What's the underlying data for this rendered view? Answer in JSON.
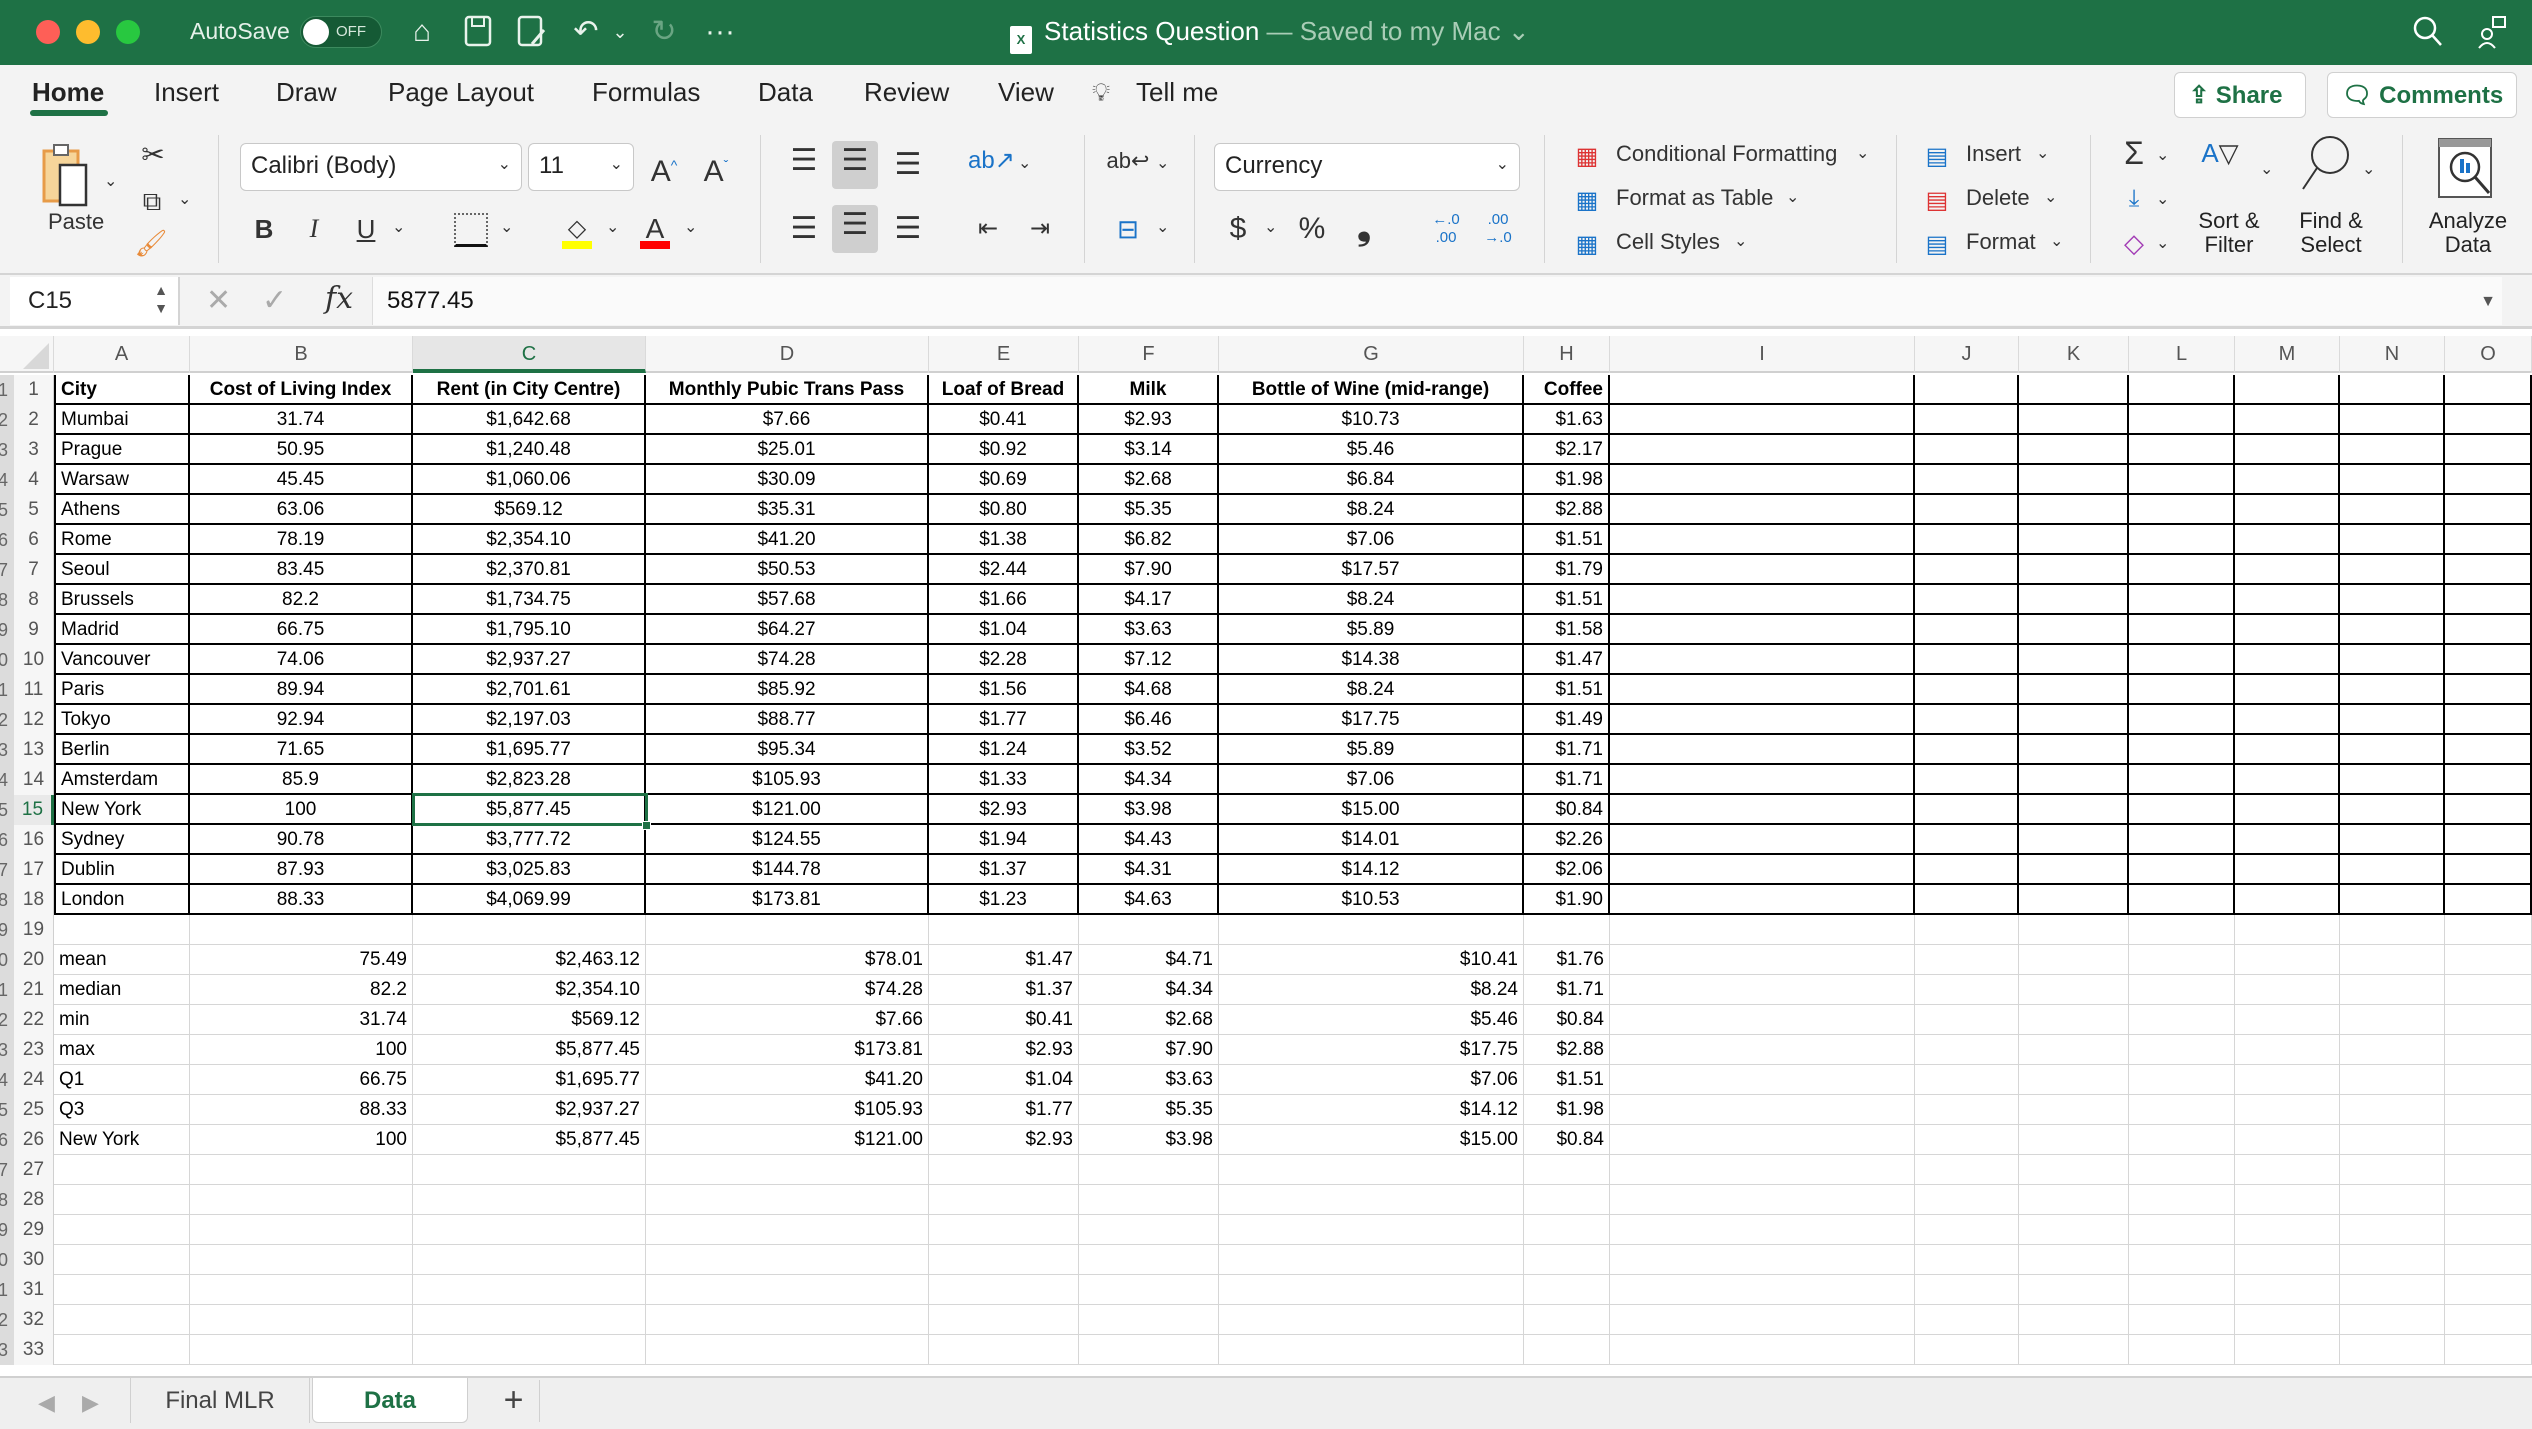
{
  "titlebar": {
    "autosave_label": "AutoSave",
    "autosave_state": "OFF",
    "doc_title": "Statistics Question",
    "doc_status": " — Saved to my Mac ⌄",
    "file_badge": "X"
  },
  "ribbon_tabs": [
    "Home",
    "Insert",
    "Draw",
    "Page Layout",
    "Formulas",
    "Data",
    "Review",
    "View",
    "Tell me"
  ],
  "active_tab": "Home",
  "share_label": "Share",
  "comments_label": "Comments",
  "ribbon": {
    "paste_label": "Paste",
    "font_name": "Calibri (Body)",
    "font_size": "11",
    "number_format": "Currency",
    "conditional_formatting": "Conditional Formatting",
    "format_as_table": "Format as Table",
    "cell_styles": "Cell Styles",
    "insert": "Insert",
    "delete": "Delete",
    "format": "Format",
    "sort_filter_1": "Sort &",
    "sort_filter_2": "Filter",
    "find_select_1": "Find &",
    "find_select_2": "Select",
    "analyze_1": "Analyze",
    "analyze_2": "Data",
    "bold": "B",
    "italic": "I",
    "underline": "U",
    "currency_symbol": "$",
    "percent_symbol": "%",
    "comma_symbol": "❟"
  },
  "formula_bar": {
    "name_box": "C15",
    "formula": "5877.45"
  },
  "columns": [
    "A",
    "B",
    "C",
    "D",
    "E",
    "F",
    "G",
    "H",
    "I",
    "J",
    "K",
    "L",
    "M",
    "N",
    "O"
  ],
  "selected_column": "C",
  "selected_row": 15,
  "header_row": [
    "City",
    "Cost of Living Index",
    "Rent (in City Centre)",
    "Monthly Pubic Trans Pass",
    "Loaf of Bread",
    "Milk",
    "Bottle of Wine (mid-range)",
    "Coffee"
  ],
  "data_rows": [
    [
      "Mumbai",
      "31.74",
      "$1,642.68",
      "$7.66",
      "$0.41",
      "$2.93",
      "$10.73",
      "$1.63"
    ],
    [
      "Prague",
      "50.95",
      "$1,240.48",
      "$25.01",
      "$0.92",
      "$3.14",
      "$5.46",
      "$2.17"
    ],
    [
      "Warsaw",
      "45.45",
      "$1,060.06",
      "$30.09",
      "$0.69",
      "$2.68",
      "$6.84",
      "$1.98"
    ],
    [
      "Athens",
      "63.06",
      "$569.12",
      "$35.31",
      "$0.80",
      "$5.35",
      "$8.24",
      "$2.88"
    ],
    [
      "Rome",
      "78.19",
      "$2,354.10",
      "$41.20",
      "$1.38",
      "$6.82",
      "$7.06",
      "$1.51"
    ],
    [
      "Seoul",
      "83.45",
      "$2,370.81",
      "$50.53",
      "$2.44",
      "$7.90",
      "$17.57",
      "$1.79"
    ],
    [
      "Brussels",
      "82.2",
      "$1,734.75",
      "$57.68",
      "$1.66",
      "$4.17",
      "$8.24",
      "$1.51"
    ],
    [
      "Madrid",
      "66.75",
      "$1,795.10",
      "$64.27",
      "$1.04",
      "$3.63",
      "$5.89",
      "$1.58"
    ],
    [
      "Vancouver",
      "74.06",
      "$2,937.27",
      "$74.28",
      "$2.28",
      "$7.12",
      "$14.38",
      "$1.47"
    ],
    [
      "Paris",
      "89.94",
      "$2,701.61",
      "$85.92",
      "$1.56",
      "$4.68",
      "$8.24",
      "$1.51"
    ],
    [
      "Tokyo",
      "92.94",
      "$2,197.03",
      "$88.77",
      "$1.77",
      "$6.46",
      "$17.75",
      "$1.49"
    ],
    [
      "Berlin",
      "71.65",
      "$1,695.77",
      "$95.34",
      "$1.24",
      "$3.52",
      "$5.89",
      "$1.71"
    ],
    [
      "Amsterdam",
      "85.9",
      "$2,823.28",
      "$105.93",
      "$1.33",
      "$4.34",
      "$7.06",
      "$1.71"
    ],
    [
      "New York",
      "100",
      "$5,877.45",
      "$121.00",
      "$2.93",
      "$3.98",
      "$15.00",
      "$0.84"
    ],
    [
      "Sydney",
      "90.78",
      "$3,777.72",
      "$124.55",
      "$1.94",
      "$4.43",
      "$14.01",
      "$2.26"
    ],
    [
      "Dublin",
      "87.93",
      "$3,025.83",
      "$144.78",
      "$1.37",
      "$4.31",
      "$14.12",
      "$2.06"
    ],
    [
      "London",
      "88.33",
      "$4,069.99",
      "$173.81",
      "$1.23",
      "$4.63",
      "$10.53",
      "$1.90"
    ]
  ],
  "stats_rows": [
    [
      "mean",
      "75.49",
      "$2,463.12",
      "$78.01",
      "$1.47",
      "$4.71",
      "$10.41",
      "$1.76"
    ],
    [
      "median",
      "82.2",
      "$2,354.10",
      "$74.28",
      "$1.37",
      "$4.34",
      "$8.24",
      "$1.71"
    ],
    [
      "min",
      "31.74",
      "$569.12",
      "$7.66",
      "$0.41",
      "$2.68",
      "$5.46",
      "$0.84"
    ],
    [
      "max",
      "100",
      "$5,877.45",
      "$173.81",
      "$2.93",
      "$7.90",
      "$17.75",
      "$2.88"
    ],
    [
      "Q1",
      "66.75",
      "$1,695.77",
      "$41.20",
      "$1.04",
      "$3.63",
      "$7.06",
      "$1.51"
    ],
    [
      "Q3",
      "88.33",
      "$2,937.27",
      "$105.93",
      "$1.77",
      "$5.35",
      "$14.12",
      "$1.98"
    ],
    [
      "New York",
      "100",
      "$5,877.45",
      "$121.00",
      "$2.93",
      "$3.98",
      "$15.00",
      "$0.84"
    ]
  ],
  "visible_row_count": 33,
  "sheets": [
    {
      "name": "Final MLR",
      "active": false
    },
    {
      "name": "Data",
      "active": true
    }
  ],
  "add_sheet_label": "+",
  "colors": {
    "brand": "#1e7145",
    "highlight_fill": "#ffff00",
    "font_color": "#ff0000"
  }
}
